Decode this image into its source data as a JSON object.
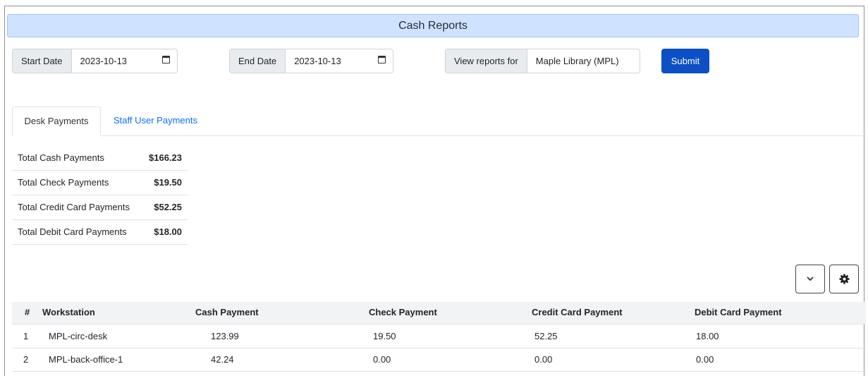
{
  "header": {
    "title": "Cash Reports"
  },
  "filters": {
    "start_label": "Start Date",
    "start_value": "2023-10-13",
    "end_label": "End Date",
    "end_value": "2023-10-13",
    "org_label": "View reports for",
    "org_value": "Maple Library (MPL)",
    "submit_label": "Submit"
  },
  "tabs": [
    {
      "label": "Desk Payments",
      "active": true
    },
    {
      "label": "Staff User Payments",
      "active": false
    }
  ],
  "summary": [
    {
      "label": "Total Cash Payments",
      "value": "$166.23"
    },
    {
      "label": "Total Check Payments",
      "value": "$19.50"
    },
    {
      "label": "Total Credit Card Payments",
      "value": "$52.25"
    },
    {
      "label": "Total Debit Card Payments",
      "value": "$18.00"
    }
  ],
  "grid_actions": {
    "expand_icon": "chevron-down-icon",
    "settings_icon": "gear-icon"
  },
  "table": {
    "columns": [
      "#",
      "Workstation",
      "Cash Payment",
      "Check Payment",
      "Credit Card Payment",
      "Debit Card Payment"
    ],
    "rows": [
      [
        "1",
        "MPL-circ-desk",
        "123.99",
        "19.50",
        "52.25",
        "18.00"
      ],
      [
        "2",
        "MPL-back-office-1",
        "42.24",
        "0.00",
        "0.00",
        "0.00"
      ]
    ]
  },
  "colors": {
    "accent": "#0d4fc4",
    "title_bg": "#cfe2ff",
    "tab_link": "#0d6efd"
  }
}
